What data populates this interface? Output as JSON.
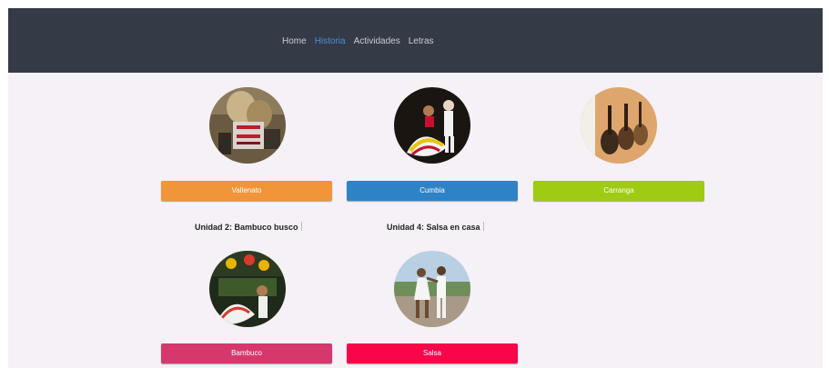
{
  "nav": {
    "items": [
      {
        "label": "Home"
      },
      {
        "label": "Historia"
      },
      {
        "label": "Actividades"
      },
      {
        "label": "Letras"
      }
    ],
    "active_color": "#4f8de3"
  },
  "cards": [
    {
      "label": "Vallenato",
      "color": "#f0953a",
      "image": "vallenato-photo"
    },
    {
      "label": "Cumbia",
      "color": "#2e83c6",
      "image": "cumbia-photo"
    },
    {
      "label": "Carranga",
      "color": "#9fcb12",
      "image": "carranga-photo"
    },
    {
      "label": "Bambuco",
      "color": "#d6386d",
      "image": "bambuco-photo"
    },
    {
      "label": "Salsa",
      "color": "#f7064a",
      "image": "salsa-photo"
    }
  ],
  "headings": {
    "bambuco": "Unidad 2: Bambuco busco",
    "salsa": "Unidad 4: Salsa en casa"
  }
}
